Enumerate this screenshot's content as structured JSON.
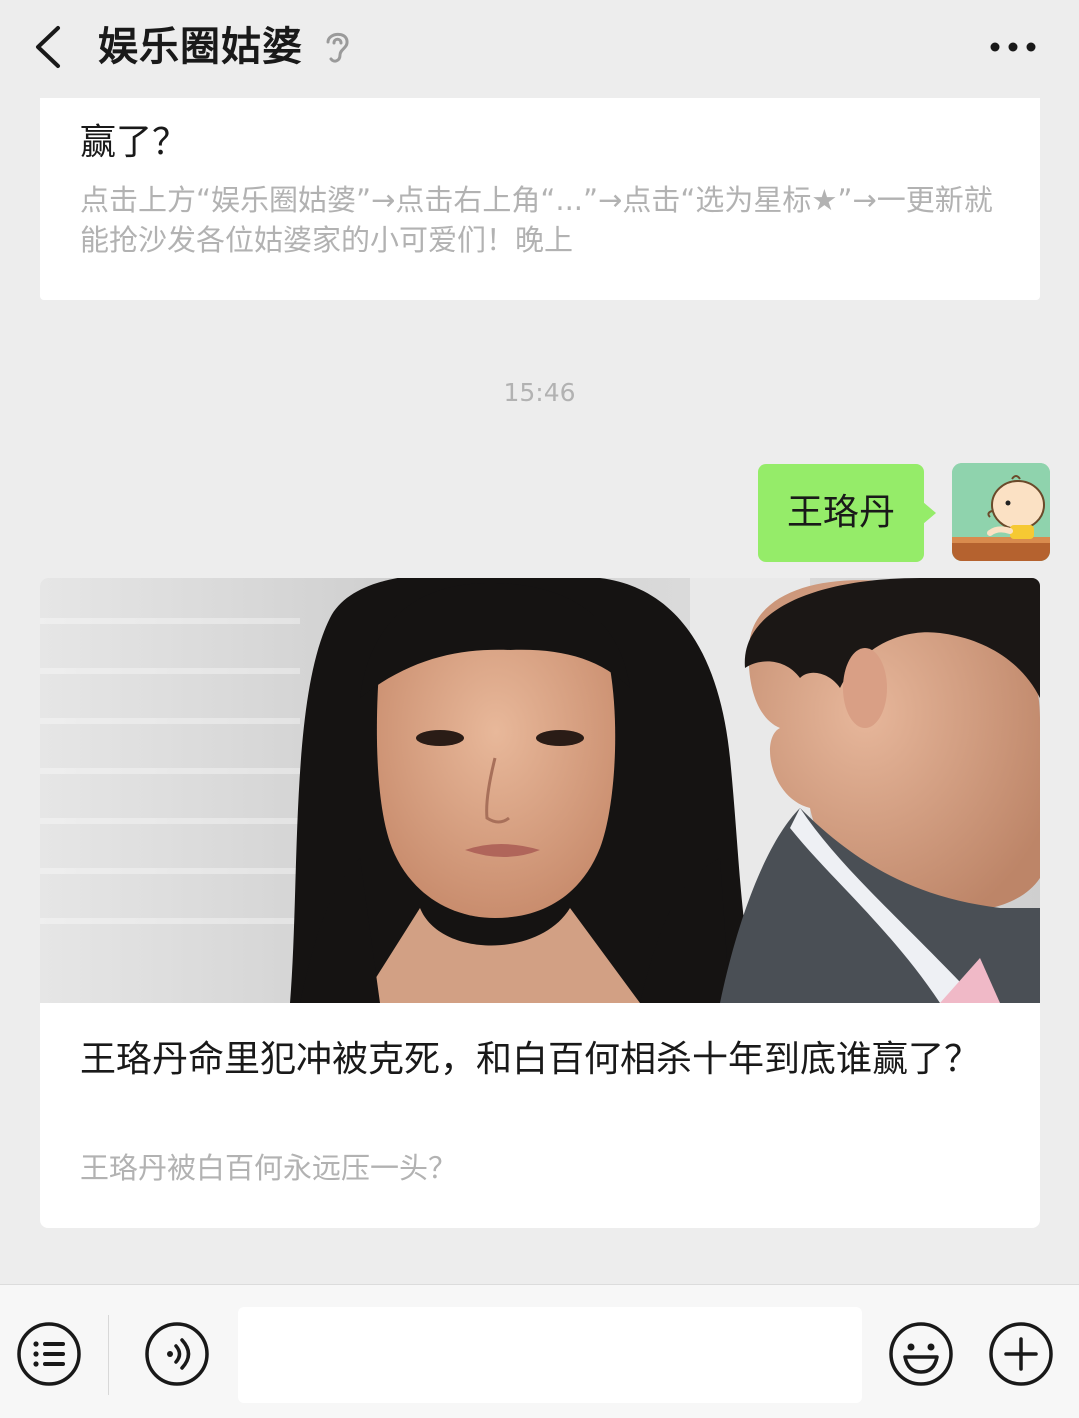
{
  "header": {
    "title": "娱乐圈姑婆",
    "back_icon": "chevron-left-icon",
    "ear_icon": "ear-icon",
    "more_icon": "more-icon"
  },
  "messages": {
    "previous_card": {
      "title_last_line": "赢了？",
      "description": "点击上方“娱乐圈姑婆”→点击右上角“...”→点击“选为星标★”→一更新就能抢沙发各位姑婆家的小可爱们！晚上"
    },
    "timestamp": "15:46",
    "sent_message": "王珞丹",
    "article_card": {
      "title": "王珞丹命里犯冲被克死，和白百何相杀十年到底谁赢了？",
      "description": "王珞丹被白百何永远压一头？"
    }
  },
  "input_bar": {
    "menu_icon": "list-menu-icon",
    "voice_icon": "voice-icon",
    "emoji_icon": "emoji-icon",
    "plus_icon": "plus-icon",
    "text_value": ""
  },
  "colors": {
    "background": "#ededed",
    "bubble_green": "#95ec69",
    "secondary_text": "#b2b2b2"
  }
}
